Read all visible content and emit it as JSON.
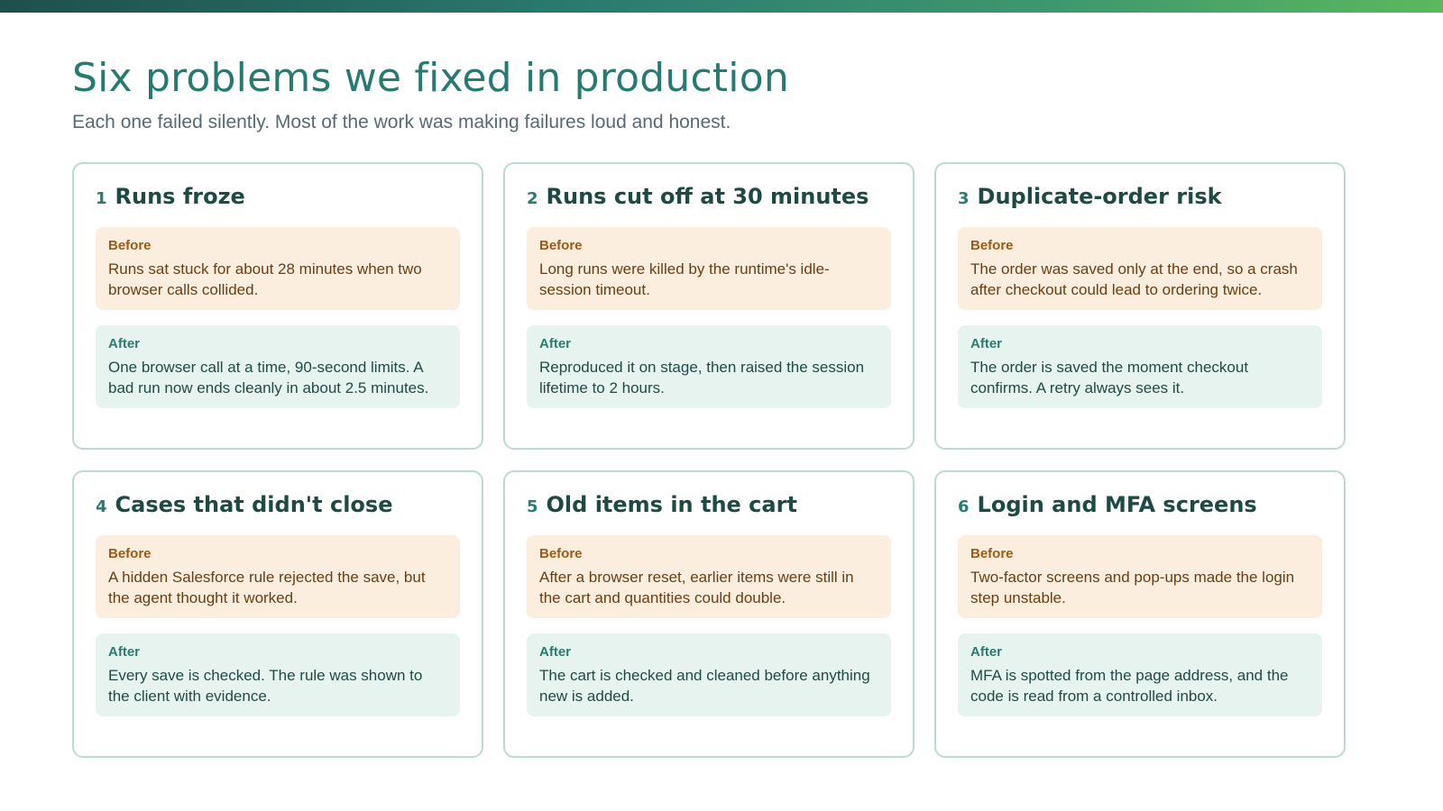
{
  "header": {
    "title": "Six problems we fixed in production",
    "subtitle": "Each one failed silently. Most of the work was making failures loud and honest."
  },
  "labels": {
    "before": "Before",
    "after": "After"
  },
  "cards": [
    {
      "num": "1",
      "title": "Runs froze",
      "before": "Runs sat stuck for about 28 minutes when two browser calls collided.",
      "after": "One browser call at a time, 90-second limits. A bad run now ends cleanly in about 2.5 minutes."
    },
    {
      "num": "2",
      "title": "Runs cut off at 30 minutes",
      "before": "Long runs were killed by the runtime's idle-session timeout.",
      "after": "Reproduced it on stage, then raised the session lifetime to 2 hours."
    },
    {
      "num": "3",
      "title": "Duplicate-order risk",
      "before": "The order was saved only at the end, so a crash after checkout could lead to ordering twice.",
      "after": "The order is saved the moment checkout confirms. A retry always sees it."
    },
    {
      "num": "4",
      "title": "Cases that didn't close",
      "before": "A hidden Salesforce rule rejected the save, but the agent thought it worked.",
      "after": "Every save is checked. The rule was shown to the client with evidence."
    },
    {
      "num": "5",
      "title": "Old items in the cart",
      "before": "After a browser reset, earlier items were still in the cart and quantities could double.",
      "after": "The cart is checked and cleaned before anything new is added."
    },
    {
      "num": "6",
      "title": "Login and MFA screens",
      "before": "Two-factor screens and pop-ups made the login step unstable.",
      "after": "MFA is spotted from the page address, and the code is read from a controlled inbox."
    }
  ]
}
